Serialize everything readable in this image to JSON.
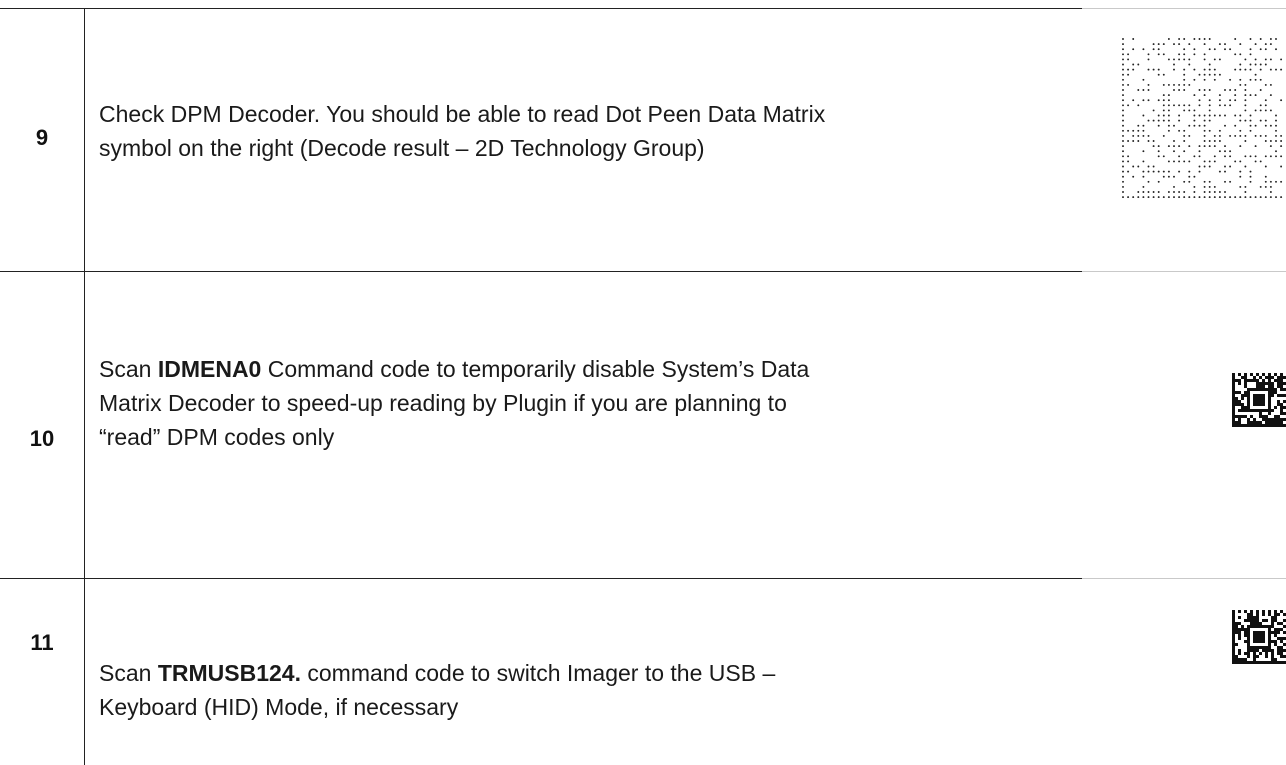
{
  "rows": [
    {
      "step": "9",
      "text_lines": [
        "Check DPM Decoder. You should be able to read Dot Peen Data Matrix",
        "symbol on the right (Decode result – 2D Technology Group)"
      ],
      "symbol": "dot-peen-data-matrix"
    },
    {
      "step": "10",
      "text_pre": "Scan ",
      "text_bold": "IDMENA0",
      "text_post": " Command code to temporarily disable System’s Data",
      "text_lines_rest": [
        "Matrix Decoder to speed-up reading by Plugin if you are planning to",
        "“read” DPM codes only"
      ],
      "symbol": "data-matrix-command-code"
    },
    {
      "step": "11",
      "text_pre": "Scan ",
      "text_bold": "TRMUSB124.",
      "text_post": " command code to switch Imager to the USB –",
      "text_lines_rest": [
        "Keyboard (HID) Mode, if necessary"
      ],
      "symbol": "data-matrix-command-code"
    }
  ]
}
